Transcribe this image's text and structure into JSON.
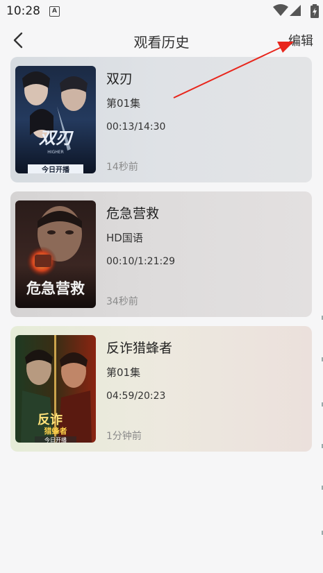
{
  "status_bar": {
    "time": "10:28",
    "notification_icon_label": "A"
  },
  "header": {
    "title": "观看历史",
    "edit_label": "编辑"
  },
  "history": [
    {
      "title": "双刃",
      "episode": "第01集",
      "progress": "00:13/14:30",
      "ago": "14秒前",
      "poster_text": "双刃",
      "poster_subtitle": "HIGHER",
      "poster_banner": "今日开播"
    },
    {
      "title": "危急营救",
      "episode": "HD国语",
      "progress": "00:10/1:21:29",
      "ago": "34秒前",
      "poster_text": "危急营救"
    },
    {
      "title": "反诈猎蜂者",
      "episode": "第01集",
      "progress": "04:59/20:23",
      "ago": "1分钟前",
      "poster_text": "反诈",
      "poster_subtitle": "猎蜂者",
      "poster_banner": "今日开播"
    }
  ]
}
